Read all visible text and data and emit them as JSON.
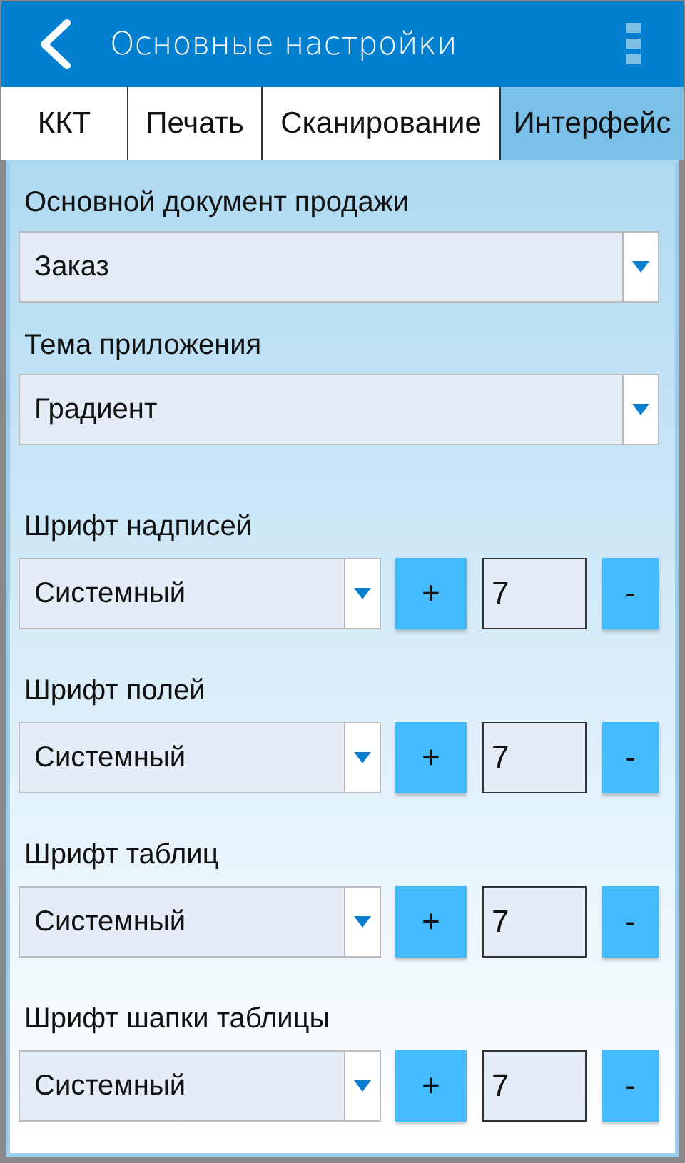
{
  "header": {
    "title": "Основные настройки"
  },
  "tabs": [
    {
      "label": "ККТ",
      "selected": false
    },
    {
      "label": "Печать",
      "selected": false
    },
    {
      "label": "Сканирование",
      "selected": false
    },
    {
      "label": "Интерфейс",
      "selected": true
    }
  ],
  "dropdowns": [
    {
      "label": "Основной документ продажи",
      "value": "Заказ"
    },
    {
      "label": "Тема приложения",
      "value": "Градиент"
    }
  ],
  "fonts": [
    {
      "label": "Шрифт надписей",
      "value": "Системный",
      "plus": "+",
      "size": "7",
      "minus": "-"
    },
    {
      "label": "Шрифт полей",
      "value": "Системный",
      "plus": "+",
      "size": "7",
      "minus": "-"
    },
    {
      "label": "Шрифт таблиц",
      "value": "Системный",
      "plus": "+",
      "size": "7",
      "minus": "-"
    },
    {
      "label": "Шрифт шапки таблицы",
      "value": "Системный",
      "plus": "+",
      "size": "7",
      "minus": "-"
    }
  ]
}
